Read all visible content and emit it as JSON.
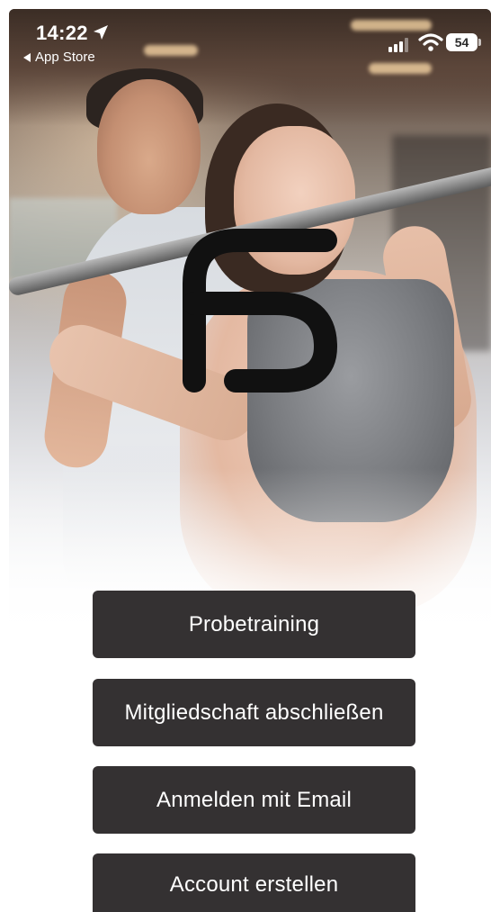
{
  "status_bar": {
    "time": "14:22",
    "back_label": "App Store",
    "battery_level": "54",
    "icons": [
      "location-arrow-icon",
      "cellular-signal-icon",
      "wifi-icon",
      "battery-icon"
    ]
  },
  "hero": {
    "logo": "FG"
  },
  "buttons": {
    "trial": "Probetraining",
    "membership": "Mitgliedschaft abschließen",
    "login_email": "Anmelden mit Email",
    "create_account": "Account erstellen"
  },
  "colors": {
    "button_bg": "#343132",
    "button_text": "#ffffff",
    "logo": "#111111"
  }
}
